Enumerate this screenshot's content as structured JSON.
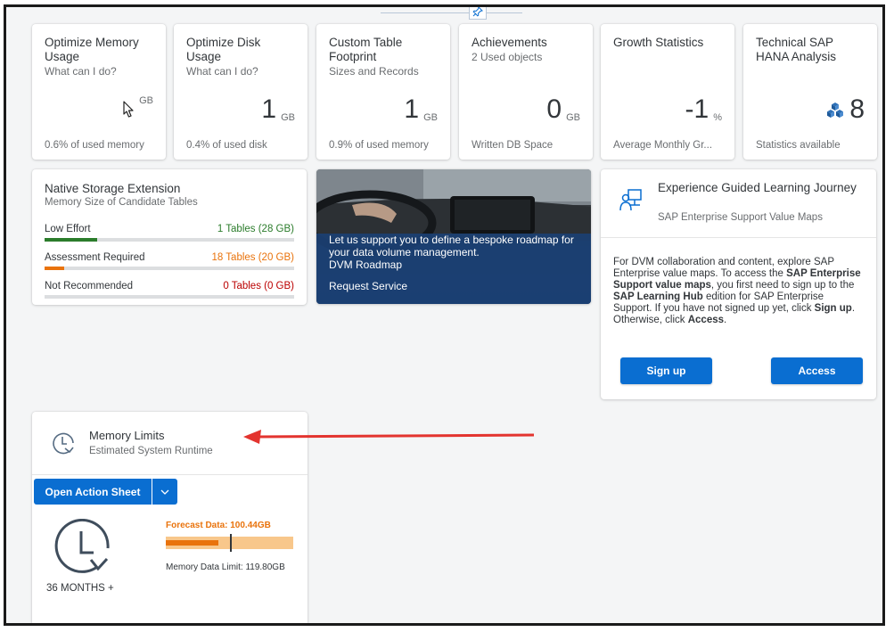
{
  "kpi_tiles": [
    {
      "title": "Optimize Memory Usage",
      "subtitle": "What can I do?",
      "value": "",
      "unit": "GB",
      "footer": "0.6% of used memory"
    },
    {
      "title": "Optimize Disk Usage",
      "subtitle": "What can I do?",
      "value": "1",
      "unit": "GB",
      "footer": "0.4% of used disk"
    },
    {
      "title": "Custom Table Footprint",
      "subtitle": "Sizes and Records",
      "value": "1",
      "unit": "GB",
      "footer": "0.9% of used memory"
    },
    {
      "title": "Achievements",
      "subtitle": "2 Used objects",
      "value": "0",
      "unit": "GB",
      "footer": "Written DB Space"
    },
    {
      "title": "Growth Statistics",
      "subtitle": "",
      "value": "-1",
      "unit": "%",
      "footer": "Average Monthly Gr..."
    },
    {
      "title": "Technical SAP HANA Analysis",
      "subtitle": "",
      "value": "8",
      "unit": "",
      "footer": "Statistics available"
    }
  ],
  "nse": {
    "title": "Native Storage Extension",
    "subtitle": "Memory Size of Candidate Tables",
    "rows": [
      {
        "label": "Low Effort",
        "value": "1 Tables (28 GB)",
        "color": "#2b7c2b",
        "fill": 0.21
      },
      {
        "label": "Assessment Required",
        "value": "18 Tables (20 GB)",
        "color": "#e9730c",
        "fill": 0.08
      },
      {
        "label": "Not Recommended",
        "value": "0 Tables (0 GB)",
        "color": "#bb0000",
        "fill": 0
      }
    ]
  },
  "banner": {
    "text": "Let us support you to define a bespoke roadmap for your data volume management.",
    "subtext": "DVM Roadmap",
    "link": "Request Service"
  },
  "egl": {
    "title": "Experience Guided Learning Journey",
    "subtitle": "SAP Enterprise Support Value Maps",
    "body_1": "For DVM collaboration and content, explore SAP Enterprise value maps. To access the ",
    "body_b1": "SAP Enterprise Support value maps",
    "body_2": ", you first need to sign up to the ",
    "body_b2": "SAP Learning Hub",
    "body_3": " edition for SAP Enterprise Support. If you have not signed up yet, click ",
    "body_b3": "Sign up",
    "body_4": ". Otherwise, click ",
    "body_b4": "Access",
    "body_5": ".",
    "signup_label": "Sign up",
    "access_label": "Access"
  },
  "memory_limits": {
    "title": "Memory Limits",
    "subtitle": "Estimated System Runtime",
    "action_label": "Open Action Sheet",
    "forecast_label": "Forecast Data: 100.44GB",
    "limit_label": "Memory Data Limit: 119.80GB",
    "runtime_label": "36 MONTHS +",
    "forecast_fill": 0.41,
    "limit_marker": 0.5
  },
  "colors": {
    "accent": "#0a6ed1",
    "forecast": "#e9730c",
    "forecast_bg": "#f8c78b",
    "annotation_arrow": "#e3342f"
  }
}
